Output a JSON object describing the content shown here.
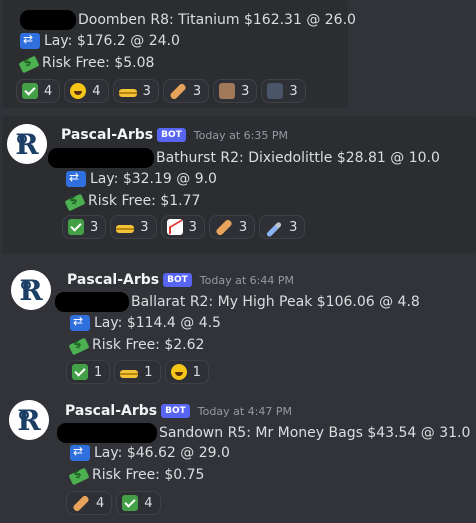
{
  "messages": [
    {
      "id": "m0",
      "username": "",
      "race": "Doomben R8: Titanium $162.31 @ 26.0",
      "lay": "Lay: $176.2 @ 24.0",
      "risk_free": "Risk Free: $5.08",
      "reactions": [
        {
          "icon": "check-icon",
          "count": "4"
        },
        {
          "icon": "laughing-emoji-icon",
          "count": "4"
        },
        {
          "icon": "gold-bars-icon",
          "count": "3"
        },
        {
          "icon": "bandage-icon",
          "count": "3"
        },
        {
          "icon": "custom-face-icon-1",
          "count": "3"
        },
        {
          "icon": "custom-face-icon-2",
          "count": "3"
        }
      ]
    },
    {
      "id": "m1",
      "username": "Pascal-Arbs",
      "badge": "BOT",
      "timestamp": "Today at 6:35 PM",
      "race": "Bathurst R2: Dixiedolittle $28.81 @ 10.0",
      "lay": "Lay: $32.19 @ 9.0",
      "risk_free": "Risk Free: $1.77",
      "reactions": [
        {
          "icon": "check-icon",
          "count": "3"
        },
        {
          "icon": "gold-bars-icon",
          "count": "3"
        },
        {
          "icon": "chart-increasing-icon",
          "count": "3"
        },
        {
          "icon": "bandage-icon",
          "count": "3"
        },
        {
          "icon": "syringe-icon",
          "count": "3"
        }
      ]
    },
    {
      "id": "m2",
      "username": "Pascal-Arbs",
      "badge": "BOT",
      "timestamp": "Today at 6:44 PM",
      "race": "Ballarat R2: My High Peak $106.06 @ 4.8",
      "lay": "Lay: $114.4 @ 4.5",
      "risk_free": "Risk Free: $2.62",
      "reactions": [
        {
          "icon": "check-icon",
          "count": "1"
        },
        {
          "icon": "gold-bars-icon",
          "count": "1"
        },
        {
          "icon": "laughing-emoji-icon",
          "count": "1"
        }
      ]
    },
    {
      "id": "m3",
      "username": "Pascal-Arbs",
      "badge": "BOT",
      "timestamp": "Today at 4:47 PM",
      "race": "Sandown R5: Mr Money Bags $43.54 @ 31.0",
      "lay": "Lay: $46.62 @ 29.0",
      "risk_free": "Risk Free: $0.75",
      "reactions": [
        {
          "icon": "bandage-icon",
          "count": "4"
        },
        {
          "icon": "check-icon",
          "count": "4"
        }
      ]
    }
  ]
}
